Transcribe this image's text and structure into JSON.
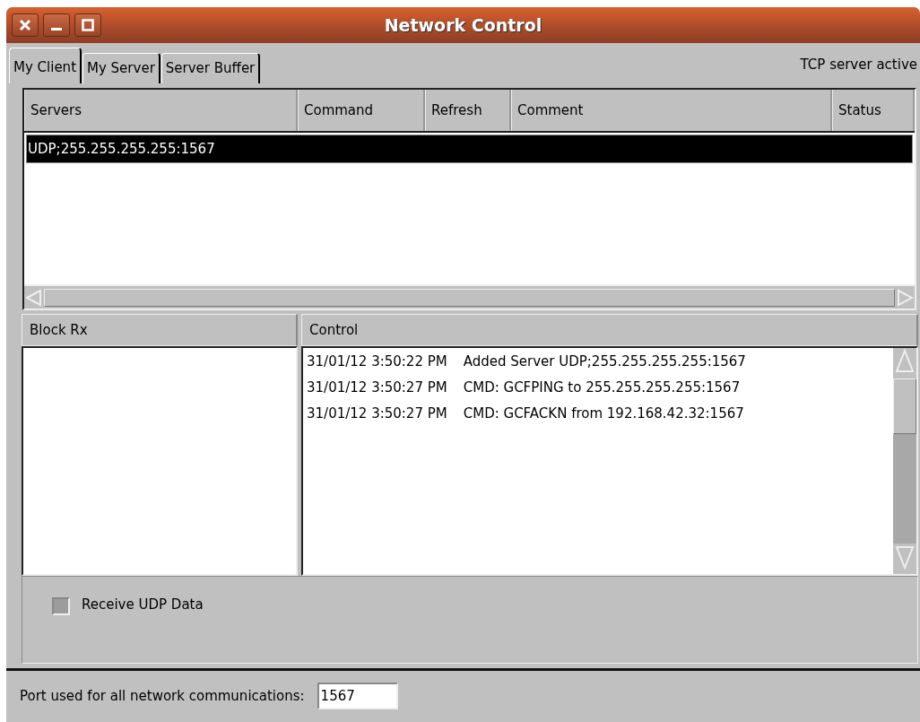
{
  "window": {
    "title": "Network Control"
  },
  "tabs": [
    {
      "label": "My Client",
      "selected": true
    },
    {
      "label": "My Server",
      "selected": false
    },
    {
      "label": "Server Buffer",
      "selected": false
    }
  ],
  "server_status": "TCP server active",
  "servers_table": {
    "columns": [
      "Servers",
      "Command",
      "Refresh",
      "Comment",
      "Status"
    ],
    "rows": [
      {
        "server": "UDP;255.255.255.255:1567",
        "selected": true
      }
    ]
  },
  "block_rx": {
    "title": "Block Rx"
  },
  "control": {
    "title": "Control",
    "log": [
      {
        "time": "31/01/12 3:50:22 PM",
        "message": "Added Server UDP;255.255.255.255:1567"
      },
      {
        "time": "31/01/12 3:50:27 PM",
        "message": "CMD: GCFPING to 255.255.255.255:1567"
      },
      {
        "time": "31/01/12 3:50:27 PM",
        "message": "CMD: GCFACKN from 192.168.42.32:1567"
      }
    ]
  },
  "receive_udp": {
    "label": "Receive UDP Data",
    "checked": false
  },
  "port": {
    "label": "Port used for all network communications:",
    "value": "1567"
  }
}
